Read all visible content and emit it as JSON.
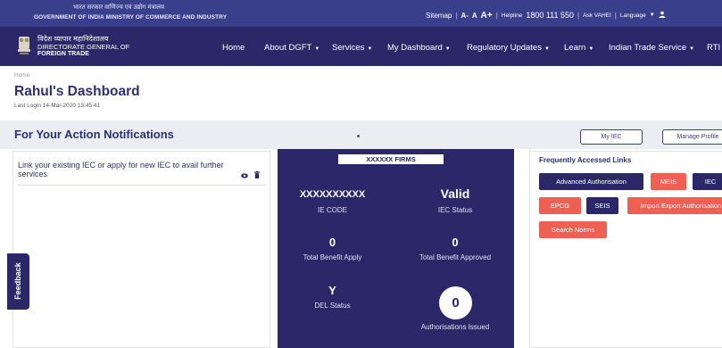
{
  "topbar": {
    "gov_hindi": "भारत सरकार  वाणिज्य एवं उद्योग मंत्रालय",
    "gov_english": "GOVERNMENT OF INDIA  MINISTRY OF COMMERCE AND INDUSTRY",
    "sitemap": "Sitemap",
    "font_small": "A-",
    "font_normal": "A",
    "font_large": "A+",
    "helpline_label": "Helpline",
    "helpline_number": "1800 111 550",
    "ask_vahei": "Ask VAHEI",
    "language": "Language",
    "language_icon": "chevron-down-icon",
    "user_icon": "user-icon"
  },
  "brand": {
    "hindi": "विदेश व्यापार महानिदेशालय",
    "line1": "DIRECTORATE GENERAL OF",
    "line2": "FOREIGN TRADE",
    "emblem_icon": "national-emblem-icon"
  },
  "nav": {
    "home": "Home",
    "about": "About DGFT",
    "services": "Services",
    "dashboard": "My Dashboard",
    "regulatory": "Regulatory Updates",
    "learn": "Learn",
    "its": "Indian Trade Service",
    "rti": "RTI"
  },
  "breadcrumb": "Home",
  "page_title": "Rahul's Dashboard",
  "last_login": "Last Login 14-Mar-2020 13:45:41",
  "notifications": {
    "title": "For Your Action Notifications",
    "my_iec": "My IEC",
    "manage_profile": "Manage Profile"
  },
  "left_card": {
    "text": "Link your existing IEC or apply for new IEC to avail further services",
    "view_icon": "eye-icon",
    "delete_icon": "trash-icon"
  },
  "feedback": "Feedback",
  "firm": {
    "name": "XXXXXX FIRMS",
    "ie_code_value": "XXXXXXXXXX",
    "ie_code_label": "IE CODE",
    "iec_status_value": "Valid",
    "iec_status_label": "IEC Status",
    "benefit_apply_value": "0",
    "benefit_apply_label": "Total Benefit Apply",
    "benefit_approved_value": "0",
    "benefit_approved_label": "Total Benefit Approved",
    "del_status_value": "Y",
    "del_status_label": "DEL Status",
    "authorisations_value": "0",
    "authorisations_label": "Authorisations Issued"
  },
  "frequent": {
    "title": "Frequently Accessed Links",
    "advanced_authorisation": "Advanced Authorisation",
    "meis": "MEIS",
    "iec": "IEC",
    "epcg": "EPCG",
    "seis": "SEIS",
    "import_export_authorisation": "Import Export Authorisation",
    "search_norms": "Search Norms"
  },
  "colors": {
    "topbar": "#3a3f8c",
    "navbar": "#2b2769",
    "accent_red": "#ee6052",
    "title_text": "#2b2f73"
  }
}
